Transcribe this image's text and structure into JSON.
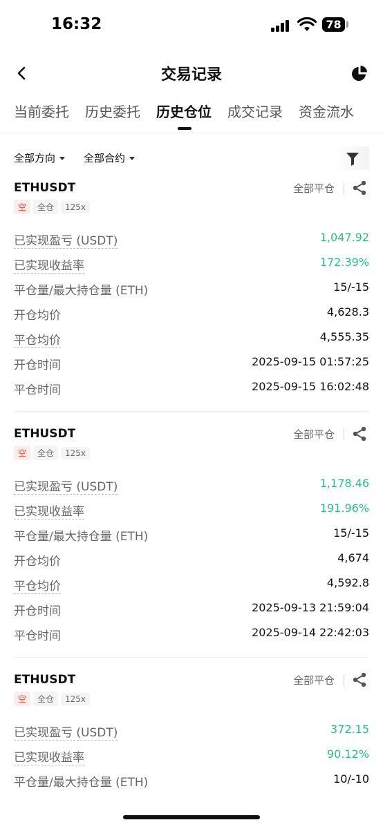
{
  "status_bar": {
    "time": "16:32",
    "battery": "78"
  },
  "nav": {
    "title": "交易记录",
    "back_icon": "chevron-left-icon",
    "right_icon": "pie-chart-icon"
  },
  "tabs": [
    {
      "label": "当前委托"
    },
    {
      "label": "历史委托"
    },
    {
      "label": "历史仓位",
      "active": true
    },
    {
      "label": "成交记录"
    },
    {
      "label": "资金流水"
    }
  ],
  "filters": {
    "direction": "全部方向",
    "contract": "全部合约",
    "filter_icon": "funnel-icon"
  },
  "labels": {
    "pnl": "已实现盈亏 (USDT)",
    "roi": "已实现收益率",
    "qty": "平仓量/最大持仓量 (ETH)",
    "open_price": "开仓均价",
    "close_price": "平仓均价",
    "open_time": "开仓时间",
    "close_time": "平仓时间"
  },
  "positions": [
    {
      "symbol": "ETHUSDT",
      "close_label": "全部平仓",
      "tags": [
        "空",
        "全仓",
        "125x"
      ],
      "pnl": "1,047.92",
      "roi": "172.39%",
      "qty": "15/-15",
      "open_price": "4,628.3",
      "close_price": "4,555.35",
      "open_time": "2025-09-15 01:57:25",
      "close_time": "2025-09-15 16:02:48"
    },
    {
      "symbol": "ETHUSDT",
      "close_label": "全部平仓",
      "tags": [
        "空",
        "全仓",
        "125x"
      ],
      "pnl": "1,178.46",
      "roi": "191.96%",
      "qty": "15/-15",
      "open_price": "4,674",
      "close_price": "4,592.8",
      "open_time": "2025-09-13 21:59:04",
      "close_time": "2025-09-14 22:42:03"
    },
    {
      "symbol": "ETHUSDT",
      "close_label": "全部平仓",
      "tags": [
        "空",
        "全仓",
        "125x"
      ],
      "pnl": "372.15",
      "roi": "90.12%",
      "qty": "10/-10"
    }
  ],
  "colors": {
    "profit": "#2ebd85",
    "short_tag": "#e05545",
    "short_tag_bg": "#fdecea"
  }
}
